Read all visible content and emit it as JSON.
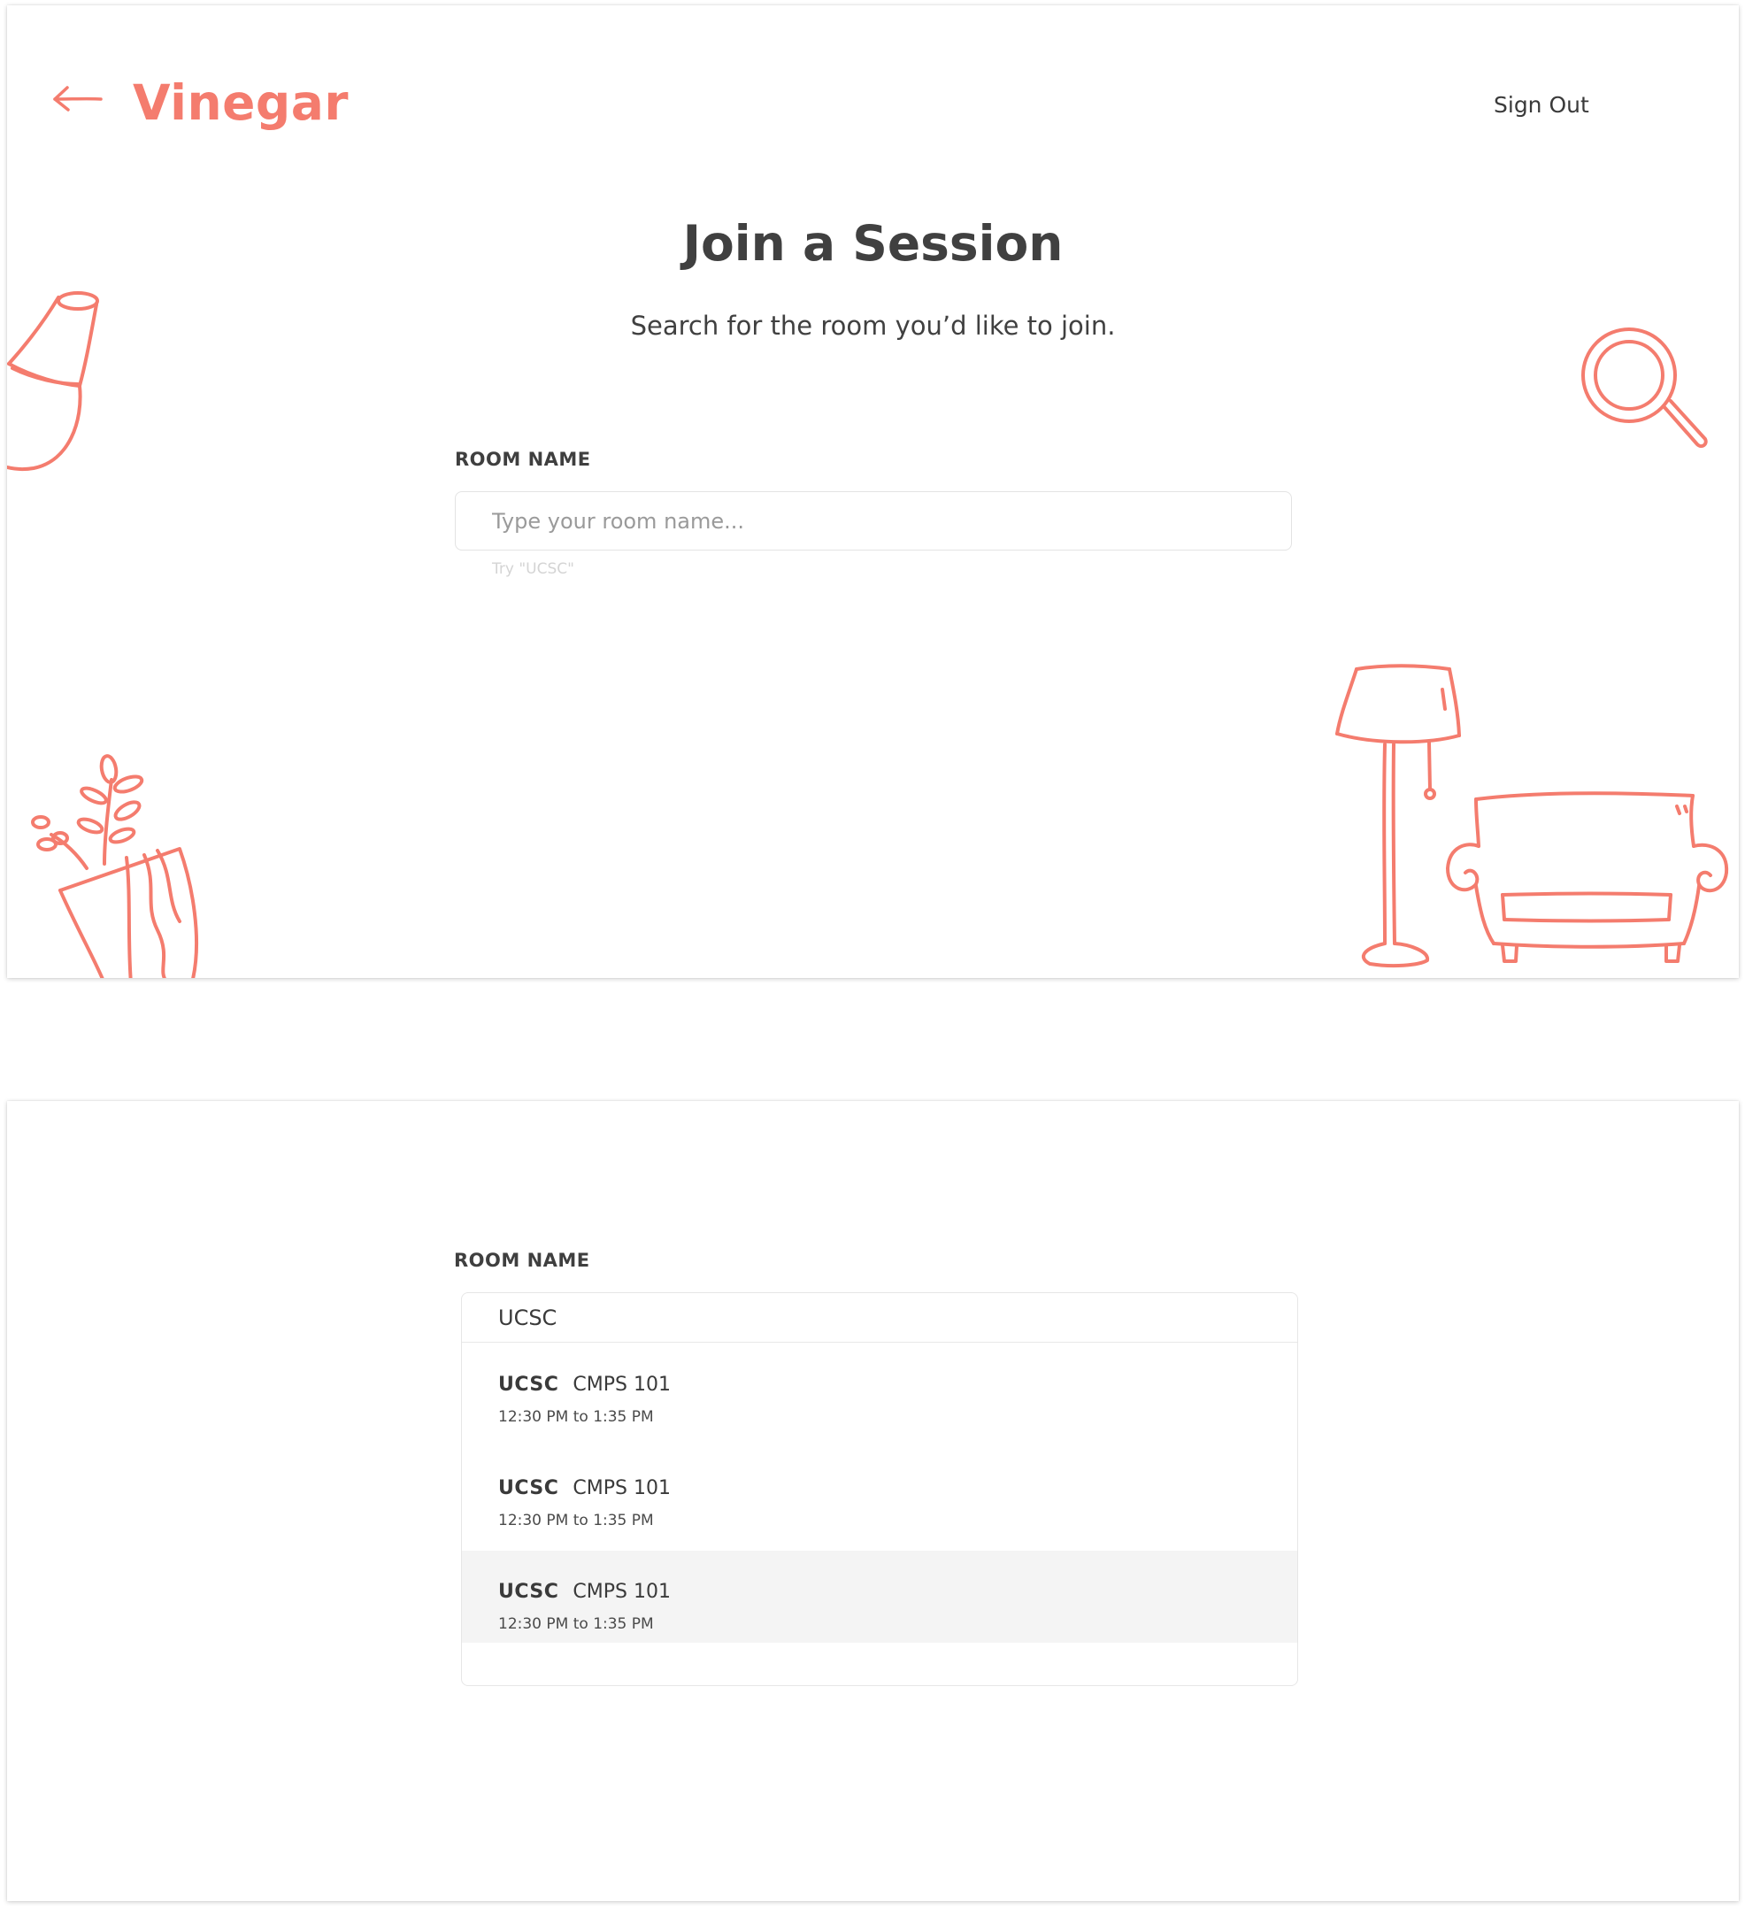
{
  "header": {
    "brand": "Vinegar",
    "sign_out": "Sign Out"
  },
  "join": {
    "title": "Join a Session",
    "subtitle": "Search for the room you’d like to join.",
    "room_label": "ROOM NAME",
    "room_placeholder": "Type your room name...",
    "hint": "Try \"UCSC\""
  },
  "search": {
    "room_label": "ROOM NAME",
    "room_value": "UCSC",
    "results": [
      {
        "code": "UCSC",
        "course": "CMPS 101",
        "time": "12:30 PM to 1:35 PM"
      },
      {
        "code": "UCSC",
        "course": "CMPS 101",
        "time": "12:30 PM to 1:35 PM"
      },
      {
        "code": "UCSC",
        "course": "CMPS 101",
        "time": "12:30 PM to 1:35 PM",
        "highlighted": true
      }
    ]
  },
  "theme": {
    "accent": "#f47c6e",
    "text": "#3c3c3c",
    "highlight_bg": "#f4f4f4"
  },
  "icons": [
    "back-arrow-icon",
    "vase-illustration",
    "magnifier-illustration",
    "plant-illustration",
    "floor-lamp-illustration",
    "armchair-illustration"
  ]
}
